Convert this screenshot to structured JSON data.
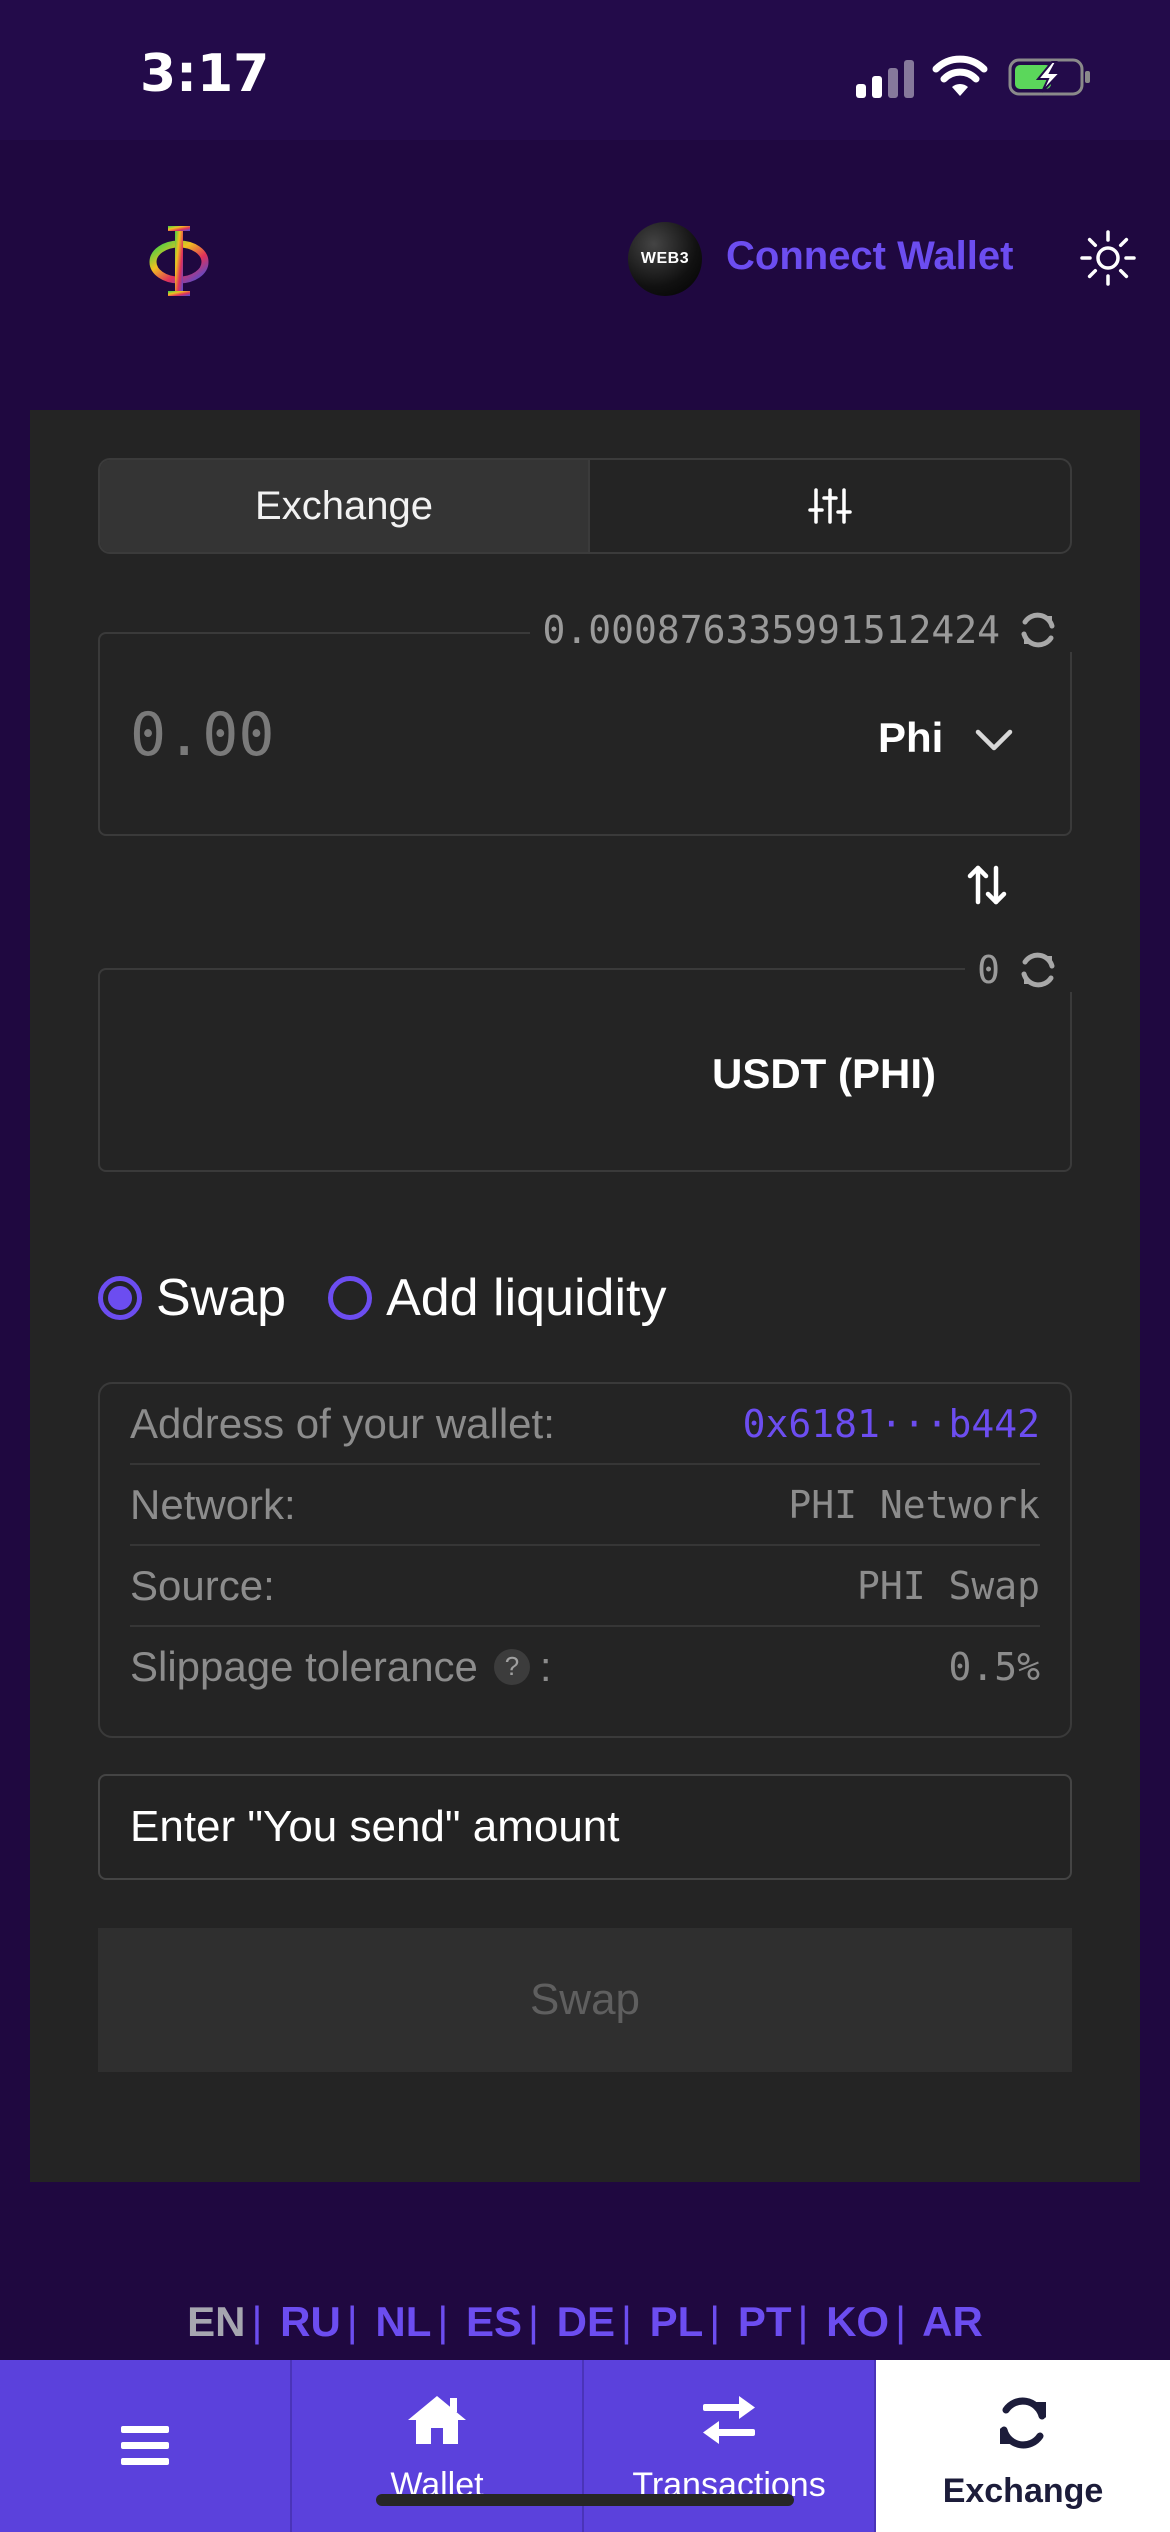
{
  "status_bar": {
    "time": "3:17"
  },
  "header": {
    "wallet_badge": "WEB3",
    "connect_label": "Connect Wallet"
  },
  "tabs": {
    "exchange_label": "Exchange"
  },
  "from": {
    "balance": "0.000876335991512424",
    "amount_placeholder": "0.00",
    "token": "Phi"
  },
  "to": {
    "balance": "0",
    "token": "USDT (PHI)"
  },
  "mode": {
    "swap_label": "Swap",
    "add_liquidity_label": "Add liquidity",
    "selected": "Swap"
  },
  "info": {
    "rows": [
      {
        "label": "Address of your wallet:",
        "value": "0x6181···b442"
      },
      {
        "label": "Network:",
        "value": "PHI Network"
      },
      {
        "label": "Source:",
        "value": "PHI Swap"
      },
      {
        "label": "Slippage tolerance",
        "help": "?",
        "suffix": ":",
        "value": "0.5%"
      }
    ]
  },
  "message": "Enter \"You send\" amount",
  "swap_button": "Swap",
  "languages": [
    "EN",
    "RU",
    "NL",
    "ES",
    "DE",
    "PL",
    "PT",
    "KO",
    "AR"
  ],
  "active_language": "EN",
  "bottom_nav": {
    "wallet": "Wallet",
    "transactions": "Transactions",
    "exchange": "Exchange"
  },
  "colors": {
    "accent": "#6c4df0",
    "background": "#1f0840",
    "card": "#242424",
    "nav": "#5b41dc"
  },
  "icons": [
    "phi-logo-icon",
    "sun-icon",
    "sliders-icon",
    "refresh-icon",
    "chevron-down-icon",
    "swap-direction-icon",
    "menu-icon",
    "home-icon",
    "transfer-icon",
    "exchange-icon"
  ]
}
